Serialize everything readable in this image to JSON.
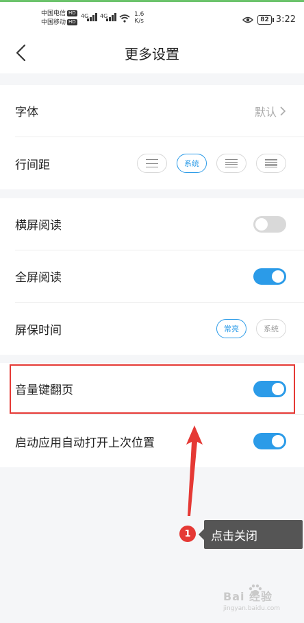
{
  "status_bar": {
    "carrier_top": "中国电信",
    "carrier_bottom": "中国移动",
    "hd": "HD",
    "sig1": "4G",
    "sig2": "4G",
    "speed_value": "1.6",
    "speed_unit": "K/s",
    "battery": "82",
    "time": "3:22"
  },
  "header": {
    "title": "更多设置"
  },
  "section1": {
    "font_label": "字体",
    "font_value": "默认",
    "spacing_label": "行间距",
    "spacing_system": "系统"
  },
  "section2": {
    "landscape_label": "横屏阅读",
    "landscape_on": false,
    "fullscreen_label": "全屏阅读",
    "fullscreen_on": true,
    "sleep_label": "屏保时间",
    "sleep_always": "常亮",
    "sleep_system": "系统"
  },
  "section3": {
    "volume_label": "音量键翻页",
    "volume_on": true,
    "resume_label": "启动应用自动打开上次位置",
    "resume_on": true
  },
  "annotation": {
    "badge": "1",
    "callout": "点击关闭"
  },
  "watermark": {
    "main": "Bai 经验",
    "sub": "jingyan.baidu.com"
  },
  "colors": {
    "accent": "#2b9be8",
    "toggle_off": "#d9d9d9",
    "highlight": "#e53935",
    "callout_bg": "#555555"
  }
}
